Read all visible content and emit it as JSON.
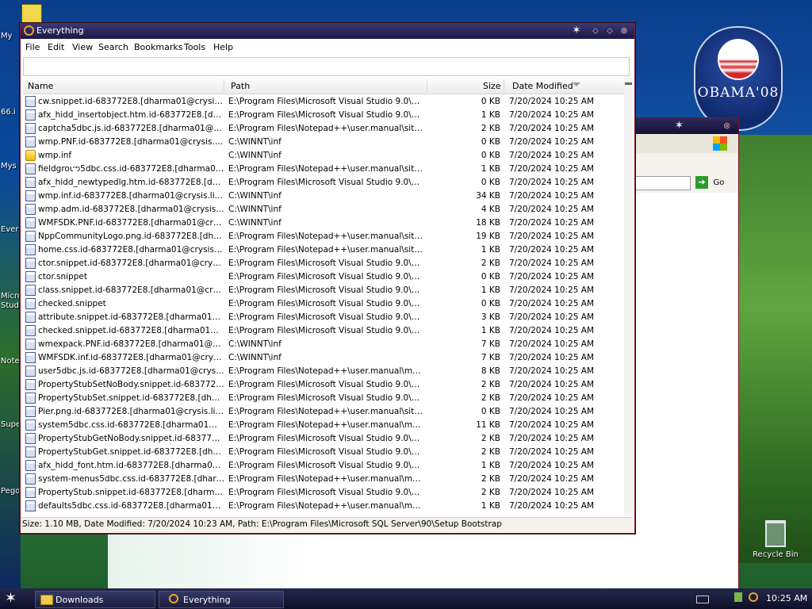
{
  "desktop": {
    "left_icon_labels": [
      "My",
      "66.i",
      "Mys",
      "Ever",
      "Micro",
      "Studi",
      "Note",
      "Supe",
      "Pego"
    ],
    "recycle_bin_label": "Recycle Bin",
    "poster_text": "OBAMA'08"
  },
  "background_window": {
    "go_label": "Go"
  },
  "window": {
    "title": "Everything",
    "menu": [
      "File",
      "Edit",
      "View",
      "Search",
      "Bookmarks",
      "Tools",
      "Help"
    ],
    "search_value": "",
    "columns": {
      "name": "Name",
      "path": "Path",
      "size": "Size",
      "date": "Date Modified"
    },
    "sort_column": "Date Modified",
    "rows": [
      {
        "icon": "file-icon",
        "name": "cw.snippet.id-683772E8.[dharma01@crysis.li...",
        "path": "E:\\Program Files\\Microsoft Visual Studio 9.0\\VC#...",
        "size": "0 KB",
        "date": "7/20/2024 10:25 AM"
      },
      {
        "icon": "file-icon",
        "name": "afx_hidd_insertobject.htm.id-683772E8.[dha...",
        "path": "E:\\Program Files\\Microsoft Visual Studio 9.0\\VC\\V...",
        "size": "1 KB",
        "date": "7/20/2024 10:25 AM"
      },
      {
        "icon": "file-icon",
        "name": "captcha5dbc.js.id-683772E8.[dharma01@cry...",
        "path": "E:\\Program Files\\Notepad++\\user.manual\\sites\\...",
        "size": "2 KB",
        "date": "7/20/2024 10:25 AM"
      },
      {
        "icon": "file-icon",
        "name": "wmp.PNF.id-683772E8.[dharma01@crysis.life...",
        "path": "C:\\WINNT\\inf",
        "size": "0 KB",
        "date": "7/20/2024 10:25 AM"
      },
      {
        "icon": "inf-file-icon",
        "name": "wmp.inf",
        "path": "C:\\WINNT\\inf",
        "size": "0 KB",
        "date": "7/20/2024 10:25 AM"
      },
      {
        "icon": "file-icon",
        "name": "fieldgroup5dbc.css.id-683772E8.[dharma01@...",
        "path": "E:\\Program Files\\Notepad++\\user.manual\\sites\\...",
        "size": "1 KB",
        "date": "7/20/2024 10:25 AM"
      },
      {
        "icon": "file-icon",
        "name": "afx_hidd_newtypedlg.htm.id-683772E8.[dha...",
        "path": "E:\\Program Files\\Microsoft Visual Studio 9.0\\VC\\V...",
        "size": "0 KB",
        "date": "7/20/2024 10:25 AM"
      },
      {
        "icon": "file-icon",
        "name": "wmp.inf.id-683772E8.[dharma01@crysis.life]...",
        "path": "C:\\WINNT\\inf",
        "size": "34 KB",
        "date": "7/20/2024 10:25 AM"
      },
      {
        "icon": "file-icon",
        "name": "wmp.adm.id-683772E8.[dharma01@crysis.lif...",
        "path": "C:\\WINNT\\inf",
        "size": "4 KB",
        "date": "7/20/2024 10:25 AM"
      },
      {
        "icon": "file-icon",
        "name": "WMFSDK.PNF.id-683772E8.[dharma01@crysi...",
        "path": "C:\\WINNT\\inf",
        "size": "18 KB",
        "date": "7/20/2024 10:25 AM"
      },
      {
        "icon": "file-icon",
        "name": "NppCommunityLogo.png.id-683772E8.[dharm...",
        "path": "E:\\Program Files\\Notepad++\\user.manual\\sites\\...",
        "size": "19 KB",
        "date": "7/20/2024 10:25 AM"
      },
      {
        "icon": "file-icon",
        "name": "home.css.id-683772E8.[dharma01@crysis.life...",
        "path": "E:\\Program Files\\Notepad++\\user.manual\\sites\\...",
        "size": "1 KB",
        "date": "7/20/2024 10:25 AM"
      },
      {
        "icon": "file-icon",
        "name": "ctor.snippet.id-683772E8.[dharma01@crysis....",
        "path": "E:\\Program Files\\Microsoft Visual Studio 9.0\\VC#...",
        "size": "2 KB",
        "date": "7/20/2024 10:25 AM"
      },
      {
        "icon": "file-icon",
        "name": "ctor.snippet",
        "path": "E:\\Program Files\\Microsoft Visual Studio 9.0\\VC#...",
        "size": "0 KB",
        "date": "7/20/2024 10:25 AM"
      },
      {
        "icon": "file-icon",
        "name": "class.snippet.id-683772E8.[dharma01@crysis...",
        "path": "E:\\Program Files\\Microsoft Visual Studio 9.0\\VC#...",
        "size": "1 KB",
        "date": "7/20/2024 10:25 AM"
      },
      {
        "icon": "file-icon",
        "name": "checked.snippet",
        "path": "E:\\Program Files\\Microsoft Visual Studio 9.0\\VC#...",
        "size": "0 KB",
        "date": "7/20/2024 10:25 AM"
      },
      {
        "icon": "file-icon",
        "name": "attribute.snippet.id-683772E8.[dharma01@cr...",
        "path": "E:\\Program Files\\Microsoft Visual Studio 9.0\\VC#...",
        "size": "3 KB",
        "date": "7/20/2024 10:25 AM"
      },
      {
        "icon": "file-icon",
        "name": "checked.snippet.id-683772E8.[dharma01@cr...",
        "path": "E:\\Program Files\\Microsoft Visual Studio 9.0\\VC#...",
        "size": "1 KB",
        "date": "7/20/2024 10:25 AM"
      },
      {
        "icon": "file-icon",
        "name": "wmexpack.PNF.id-683772E8.[dharma01@cry...",
        "path": "C:\\WINNT\\inf",
        "size": "7 KB",
        "date": "7/20/2024 10:25 AM"
      },
      {
        "icon": "file-icon",
        "name": "WMFSDK.inf.id-683772E8.[dharma01@crysis....",
        "path": "C:\\WINNT\\inf",
        "size": "7 KB",
        "date": "7/20/2024 10:25 AM"
      },
      {
        "icon": "file-icon",
        "name": "user5dbc.js.id-683772E8.[dharma01@crysis.l...",
        "path": "E:\\Program Files\\Notepad++\\user.manual\\modul...",
        "size": "8 KB",
        "date": "7/20/2024 10:25 AM"
      },
      {
        "icon": "file-icon",
        "name": "PropertyStubSetNoBody.snippet.id-683772E8...",
        "path": "E:\\Program Files\\Microsoft Visual Studio 9.0\\VC#...",
        "size": "2 KB",
        "date": "7/20/2024 10:25 AM"
      },
      {
        "icon": "file-icon",
        "name": "PropertyStubSet.snippet.id-683772E8.[dhar...",
        "path": "E:\\Program Files\\Microsoft Visual Studio 9.0\\VC#...",
        "size": "2 KB",
        "date": "7/20/2024 10:25 AM"
      },
      {
        "icon": "file-icon",
        "name": "Pier.png.id-683772E8.[dharma01@crysis.life]...",
        "path": "E:\\Program Files\\Notepad++\\user.manual\\sites\\...",
        "size": "0 KB",
        "date": "7/20/2024 10:25 AM"
      },
      {
        "icon": "file-icon",
        "name": "system5dbc.css.id-683772E8.[dharma01@cr...",
        "path": "E:\\Program Files\\Notepad++\\user.manual\\modul...",
        "size": "11 KB",
        "date": "7/20/2024 10:25 AM"
      },
      {
        "icon": "file-icon",
        "name": "PropertyStubGetNoBody.snippet.id-683772E...",
        "path": "E:\\Program Files\\Microsoft Visual Studio 9.0\\VC#...",
        "size": "2 KB",
        "date": "7/20/2024 10:25 AM"
      },
      {
        "icon": "file-icon",
        "name": "PropertyStubGet.snippet.id-683772E8.[dhar...",
        "path": "E:\\Program Files\\Microsoft Visual Studio 9.0\\VC#...",
        "size": "2 KB",
        "date": "7/20/2024 10:25 AM"
      },
      {
        "icon": "file-icon",
        "name": "afx_hidd_font.htm.id-683772E8.[dharma01@...",
        "path": "E:\\Program Files\\Microsoft Visual Studio 9.0\\VC\\V...",
        "size": "1 KB",
        "date": "7/20/2024 10:25 AM"
      },
      {
        "icon": "file-icon",
        "name": "system-menus5dbc.css.id-683772E8.[dharma...",
        "path": "E:\\Program Files\\Notepad++\\user.manual\\modul...",
        "size": "2 KB",
        "date": "7/20/2024 10:25 AM"
      },
      {
        "icon": "file-icon",
        "name": "PropertyStub.snippet.id-683772E8.[dharma0...",
        "path": "E:\\Program Files\\Microsoft Visual Studio 9.0\\VC#...",
        "size": "2 KB",
        "date": "7/20/2024 10:25 AM"
      },
      {
        "icon": "file-icon",
        "name": "defaults5dbc.css.id-683772E8.[dharma01@cr...",
        "path": "E:\\Program Files\\Notepad++\\user.manual\\modul...",
        "size": "1 KB",
        "date": "7/20/2024 10:25 AM"
      }
    ],
    "status": "Size: 1.10 MB, Date Modified: 7/20/2024 10:23 AM, Path: E:\\Program Files\\Microsoft SQL Server\\90\\Setup Bootstrap"
  },
  "taskbar": {
    "buttons": [
      "Downloads",
      "Everything"
    ],
    "clock": "10:25 AM"
  }
}
